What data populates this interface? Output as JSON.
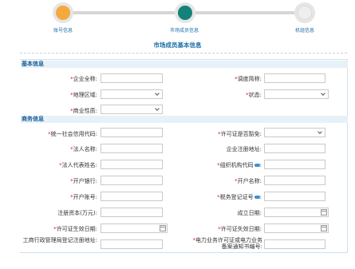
{
  "steps": [
    {
      "label": "账号信息"
    },
    {
      "label": "市场成员信息"
    },
    {
      "label": "机组信息"
    }
  ],
  "colors": {
    "step_done": "#f4a93c",
    "step_active": "#12827a",
    "accent": "#1b6fa8",
    "required": "#e02020"
  },
  "page_title": "市场成员基本信息",
  "sections": {
    "basic": "基本信息",
    "business": "商务信息"
  },
  "basic": {
    "company_name": "企业全称",
    "short_name": "调度简称",
    "region": "地理区域",
    "status": "状态",
    "nature": "商业性质"
  },
  "business": {
    "credit_code": "统一社会信用代码",
    "license_exempt": "许可证是否豁免",
    "legal_name": "法人名称",
    "reg_address": "企业注册地址",
    "legal_rep": "法人代表姓名",
    "org_code": "组织机构代码",
    "bank": "开户银行",
    "account_name": "开户名称",
    "account_no": "开户账号",
    "tax_no": "税务登记证号",
    "capital": "注册资本(万元)",
    "found_date": "成立日期",
    "license_valid": "许可证生效日期",
    "license_invalid": "许可证失效日期",
    "icbc_address": "工商行政管理局登记注册地址",
    "power_license": "电力业务许可证或电力业务备案通知书编号"
  }
}
